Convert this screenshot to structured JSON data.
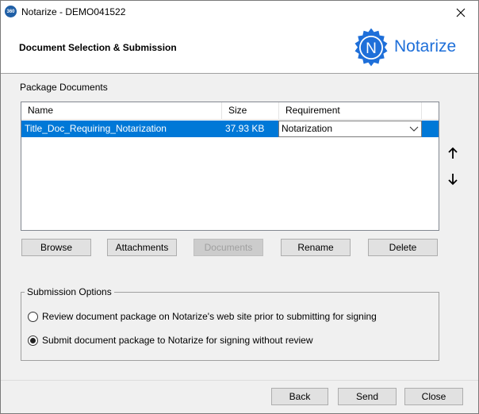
{
  "window": {
    "title": "Notarize - DEMO041522",
    "app_icon_text": "360",
    "close_glyph": "✕"
  },
  "header": {
    "title": "Document Selection & Submission",
    "logo_letter": "N",
    "logo_text": "Notarize",
    "brand_color": "#1e6fd9"
  },
  "package": {
    "label": "Package Documents",
    "columns": [
      "Name",
      "Size",
      "Requirement"
    ],
    "rows": [
      {
        "name": "Title_Doc_Requiring_Notarization",
        "size": "37.93 KB",
        "requirement": "Notarization"
      }
    ],
    "move_up_icon": "arrow-up-icon",
    "move_down_icon": "arrow-down-icon"
  },
  "actions": {
    "browse": "Browse",
    "attachments": "Attachments",
    "documents": "Documents",
    "rename": "Rename",
    "delete": "Delete"
  },
  "submission": {
    "title": "Submission Options",
    "options": [
      {
        "label": "Review document package on Notarize's web site prior to submitting for signing",
        "checked": false
      },
      {
        "label": "Submit document package to Notarize for signing without review",
        "checked": true
      }
    ]
  },
  "footer": {
    "back": "Back",
    "send": "Send",
    "close": "Close"
  },
  "colors": {
    "selection": "#0078d7",
    "window_bg": "#f0f0f0"
  }
}
